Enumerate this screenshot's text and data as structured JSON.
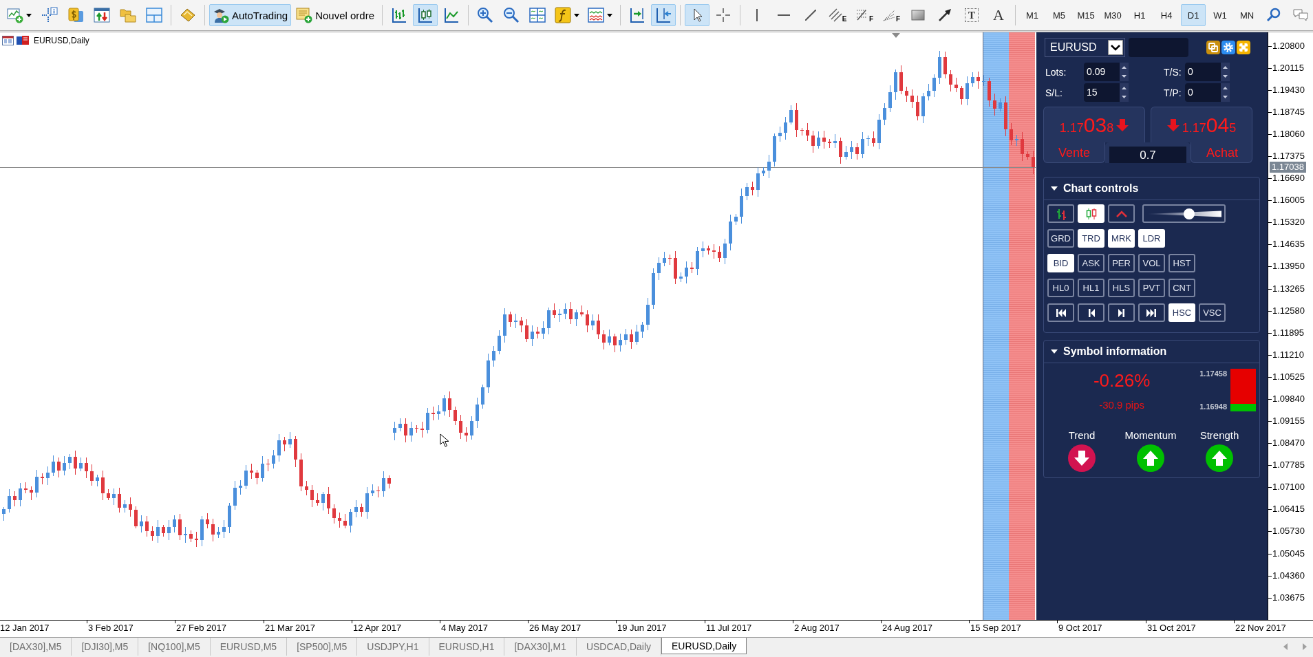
{
  "toolbar": {
    "groups": [
      [
        {
          "kind": "newchart",
          "pressed": false
        },
        {
          "kind": "datawindow",
          "pressed": false
        },
        {
          "kind": "navigator",
          "pressed": false
        },
        {
          "kind": "terminal",
          "pressed": false
        },
        {
          "kind": "profiles",
          "pressed": false
        },
        {
          "kind": "layout",
          "pressed": false
        }
      ],
      [
        {
          "kind": "editor",
          "pressed": false
        }
      ],
      [
        {
          "kind": "autotrading",
          "label": "AutoTrading",
          "pressed": true
        },
        {
          "kind": "neworder",
          "label": "Nouvel ordre",
          "pressed": false
        }
      ],
      [
        {
          "kind": "bars",
          "pressed": false
        },
        {
          "kind": "candles",
          "pressed": true
        },
        {
          "kind": "line",
          "pressed": false
        }
      ],
      [
        {
          "kind": "zoomin",
          "pressed": false
        },
        {
          "kind": "zoomout",
          "pressed": false
        },
        {
          "kind": "tile",
          "pressed": false
        },
        {
          "kind": "indicators",
          "pressed": false
        },
        {
          "kind": "templates",
          "pressed": false
        }
      ],
      [
        {
          "kind": "autoscroll",
          "pressed": false
        },
        {
          "kind": "shift",
          "pressed": true
        }
      ],
      [
        {
          "kind": "cursor",
          "pressed": true
        },
        {
          "kind": "crosshair",
          "pressed": false
        }
      ],
      [
        {
          "kind": "vline",
          "pressed": false
        },
        {
          "kind": "hline",
          "pressed": false
        },
        {
          "kind": "trendline",
          "pressed": false
        },
        {
          "kind": "channel",
          "glyph": "E",
          "pressed": false
        },
        {
          "kind": "fibo",
          "glyph": "F",
          "pressed": false
        },
        {
          "kind": "fibofan",
          "glyph": "F",
          "pressed": false
        },
        {
          "kind": "rectangle",
          "pressed": false
        },
        {
          "kind": "arrow",
          "pressed": false
        },
        {
          "kind": "textlabel",
          "glyph": "T",
          "pressed": false
        },
        {
          "kind": "text",
          "glyph": "A",
          "pressed": false
        }
      ],
      [
        {
          "kind": "period",
          "label": "M1",
          "pressed": false
        },
        {
          "kind": "period",
          "label": "M5",
          "pressed": false
        },
        {
          "kind": "period",
          "label": "M15",
          "pressed": false
        },
        {
          "kind": "period",
          "label": "M30",
          "pressed": false
        },
        {
          "kind": "period",
          "label": "H1",
          "pressed": false
        },
        {
          "kind": "period",
          "label": "H4",
          "pressed": false
        },
        {
          "kind": "period",
          "label": "D1",
          "pressed": true
        },
        {
          "kind": "period",
          "label": "W1",
          "pressed": false
        },
        {
          "kind": "period",
          "label": "MN",
          "pressed": false
        },
        {
          "kind": "search",
          "pressed": false
        },
        {
          "kind": "chat",
          "pressed": false
        }
      ]
    ]
  },
  "chart": {
    "title": "EURUSD,Daily",
    "price_labels": [
      "1.20800",
      "1.20115",
      "1.19430",
      "1.18745",
      "1.18060",
      "1.17375",
      "1.16690",
      "1.16005",
      "1.15320",
      "1.14635",
      "1.13950",
      "1.13265",
      "1.12580",
      "1.11895",
      "1.11210",
      "1.10525",
      "1.09840",
      "1.09155",
      "1.08470",
      "1.07785",
      "1.07100",
      "1.06415",
      "1.05730",
      "1.05045",
      "1.04360",
      "1.03675"
    ],
    "current_price": "1.17038",
    "date_labels": [
      "12 Jan 2017",
      "3 Feb 2017",
      "27 Feb 2017",
      "21 Mar 2017",
      "12 Apr 2017",
      "4 May 2017",
      "26 May 2017",
      "19 Jun 2017",
      "11 Jul 2017",
      "2 Aug 2017",
      "24 Aug 2017",
      "15 Sep 2017",
      "9 Oct 2017",
      "31 Oct 2017",
      "22 Nov 2017"
    ]
  },
  "trade_panel": {
    "symbol": "EURUSD",
    "fields": [
      {
        "label": "Lots:",
        "value": "0.09"
      },
      {
        "label": "T/S:",
        "value": "0"
      },
      {
        "label": "S/L:",
        "value": "15"
      },
      {
        "label": "T/P:",
        "value": "0"
      }
    ],
    "sell": {
      "price_head": "1.17",
      "price_big": "03",
      "price_tail": "8",
      "label": "Vente"
    },
    "buy": {
      "price_head": "1.17",
      "price_big": "04",
      "price_tail": "5",
      "label": "Achat"
    },
    "lot_size": "0.7"
  },
  "chart_controls": {
    "title": "Chart controls",
    "expanded": true,
    "style_buttons": [
      {
        "kind": "bars",
        "selected": false
      },
      {
        "kind": "candles",
        "selected": true
      },
      {
        "kind": "line",
        "selected": false
      }
    ],
    "zoom_slider": {
      "level": 0.57
    },
    "rows": [
      [
        {
          "kind": "text",
          "label": "GRD",
          "selected": false
        },
        {
          "kind": "text",
          "label": "TRD",
          "selected": true
        },
        {
          "kind": "text",
          "label": "MRK",
          "selected": true
        },
        {
          "kind": "text",
          "label": "LDR",
          "selected": true
        }
      ],
      [
        {
          "kind": "text",
          "label": "BID",
          "selected": true
        },
        {
          "kind": "text",
          "label": "ASK",
          "selected": false
        },
        {
          "kind": "text",
          "label": "PER",
          "selected": false
        },
        {
          "kind": "text",
          "label": "VOL",
          "selected": false
        },
        {
          "kind": "text",
          "label": "HST",
          "selected": false
        }
      ],
      [
        {
          "kind": "text",
          "label": "HL0",
          "selected": false
        },
        {
          "kind": "text",
          "label": "HL1",
          "selected": false
        },
        {
          "kind": "text",
          "label": "HLS",
          "selected": false
        },
        {
          "kind": "text",
          "label": "PVT",
          "selected": false
        },
        {
          "kind": "text",
          "label": "CNT",
          "selected": false
        }
      ],
      [
        {
          "kind": "first",
          "selected": false
        },
        {
          "kind": "back",
          "selected": false
        },
        {
          "kind": "forward",
          "selected": false
        },
        {
          "kind": "last",
          "selected": false
        },
        {
          "kind": "text",
          "label": "HSC",
          "selected": true
        },
        {
          "kind": "text",
          "label": "VSC",
          "selected": false
        }
      ]
    ]
  },
  "symbol_info": {
    "title": "Symbol information",
    "expanded": true,
    "change_percent": "-0.26%",
    "change_pips": "-30.9 pips",
    "range_high": "1.17458",
    "range_low": "1.16948",
    "range_bar": {
      "level": 0.18
    },
    "signals": [
      {
        "label": "Trend",
        "kind": "down"
      },
      {
        "label": "Momentum",
        "kind": "up"
      },
      {
        "label": "Strength",
        "kind": "up"
      }
    ]
  },
  "tabs": [
    {
      "label": "[DAX30],M5",
      "selected": false
    },
    {
      "label": "[DJI30],M5",
      "selected": false
    },
    {
      "label": "[NQ100],M5",
      "selected": false
    },
    {
      "label": "EURUSD,M5",
      "selected": false
    },
    {
      "label": "[SP500],M5",
      "selected": false
    },
    {
      "label": "USDJPY,H1",
      "selected": false
    },
    {
      "label": "EURUSD,H1",
      "selected": false
    },
    {
      "label": "[DAX30],M1",
      "selected": false
    },
    {
      "label": "USDCAD,Daily",
      "selected": false
    },
    {
      "label": "EURUSD,Daily",
      "selected": true
    }
  ]
}
